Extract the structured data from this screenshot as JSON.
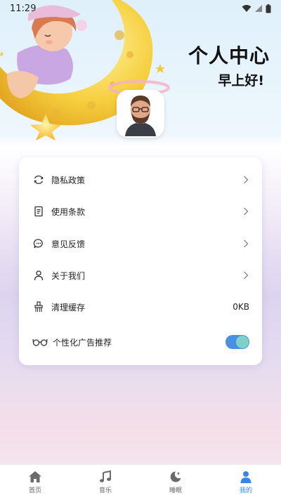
{
  "status_bar": {
    "time": "11:29"
  },
  "header": {
    "title": "个人中心",
    "greeting": "早上好!"
  },
  "menu": {
    "items": [
      {
        "label": "隐私政策",
        "icon": "refresh-icon"
      },
      {
        "label": "使用条款",
        "icon": "document-icon"
      },
      {
        "label": "意见反馈",
        "icon": "chat-bubble-icon"
      },
      {
        "label": "关于我们",
        "icon": "user-icon"
      }
    ],
    "clear_cache": {
      "label": "清理缓存",
      "value": "0KB",
      "icon": "brush-icon"
    },
    "ad_recommend": {
      "label": "个性化广告推荐",
      "icon": "glasses-icon",
      "enabled": true
    }
  },
  "nav": {
    "items": [
      {
        "label": "首页",
        "icon": "home-icon"
      },
      {
        "label": "音乐",
        "icon": "music-note-icon"
      },
      {
        "label": "睡眠",
        "icon": "moon-icon"
      },
      {
        "label": "我的",
        "icon": "person-icon"
      }
    ],
    "active_index": 3
  },
  "colors": {
    "accent": "#3a86e8",
    "toggle": "#4a90e2"
  }
}
